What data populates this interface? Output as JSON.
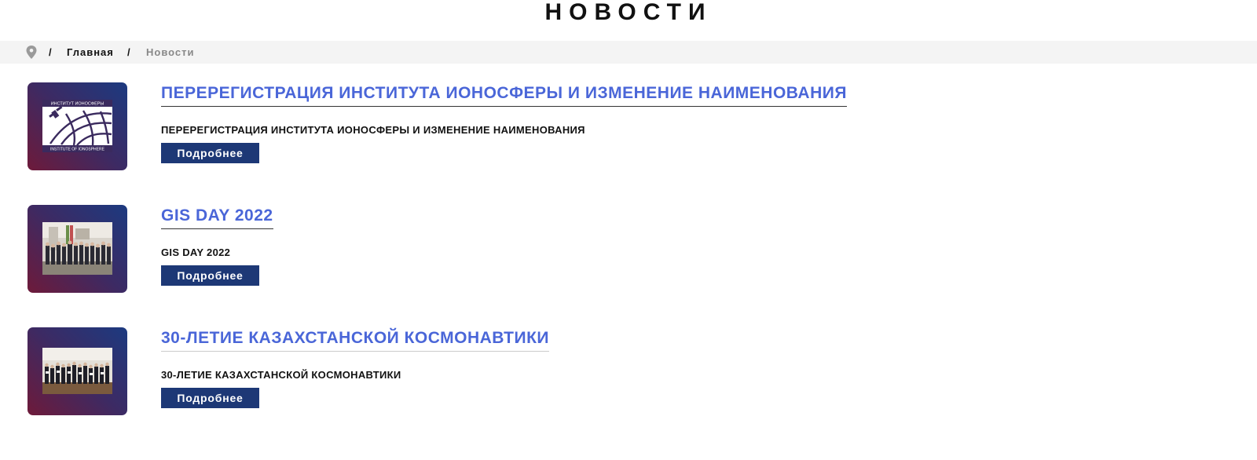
{
  "page": {
    "title": "НОВОСТИ"
  },
  "breadcrumb": {
    "icon": "map-pin-icon",
    "separator": "/",
    "home": "Главная",
    "current": "Новости"
  },
  "news": [
    {
      "title": "ПЕРЕРЕГИСТРАЦИЯ ИНСТИТУТА ИОНОСФЕРЫ И ИЗМЕНЕНИЕ НАИМЕНОВАНИЯ",
      "description": "ПЕРЕРЕГИСТРАЦИЯ ИНСТИТУТА ИОНОСФЕРЫ И ИЗМЕНЕНИЕ НАИМЕНОВАНИЯ",
      "button": "Подробнее",
      "logo_top": "ИНСТИТУТ ИОНОСФЕРЫ",
      "logo_bottom": "INSTITUTE OF IONOSPHERE"
    },
    {
      "title": "GIS DAY 2022",
      "description": "GIS DAY 2022",
      "button": "Подробнее"
    },
    {
      "title": "30-ЛЕТИЕ КАЗАХСТАНСКОЙ КОСМОНАВТИКИ",
      "description": "30-ЛЕТИЕ КАЗАХСТАНСКОЙ КОСМОНАВТИКИ",
      "button": "Подробнее"
    }
  ],
  "colors": {
    "title_link": "#4a66d8",
    "button_bg": "#1d3876",
    "breadcrumb_bg": "#f4f4f4"
  }
}
